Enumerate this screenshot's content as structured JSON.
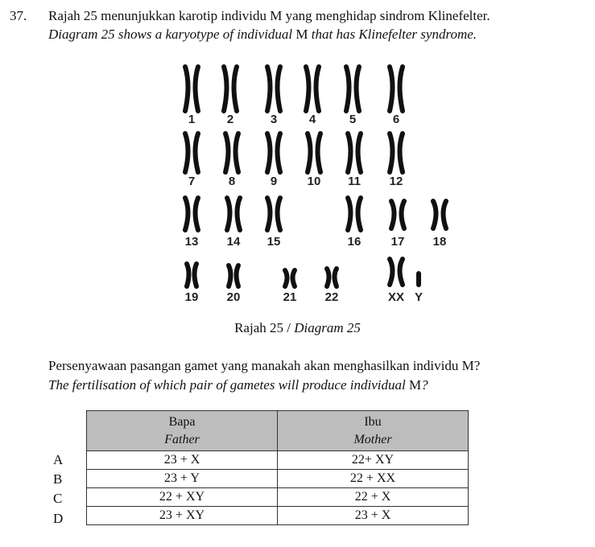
{
  "question": {
    "number": "37.",
    "intro_ms": "Rajah 25 menunjukkan karotip individu M yang menghidap sindrom Klinefelter.",
    "intro_en_part1": "Diagram 25 shows a karyotype of individual ",
    "intro_en_m": "M",
    "intro_en_part2": " that has Klinefelter syndrome.",
    "caption_ms": "Rajah 25 / ",
    "caption_en": "Diagram 25",
    "ask_ms": "Persenyawaan pasangan gamet yang manakah akan menghasilkan individu M?",
    "ask_en_part1": "The fertilisation of which pair of gametes will produce individual ",
    "ask_en_m": "M",
    "ask_en_part2": "?"
  },
  "karyotype": {
    "labels": [
      "1",
      "2",
      "3",
      "4",
      "5",
      "6",
      "7",
      "8",
      "9",
      "10",
      "11",
      "12",
      "13",
      "14",
      "15",
      "16",
      "17",
      "18",
      "19",
      "20",
      "21",
      "22",
      "XX",
      "Y"
    ]
  },
  "table": {
    "father_ms": "Bapa",
    "father_en": "Father",
    "mother_ms": "Ibu",
    "mother_en": "Mother",
    "rows": [
      {
        "letter": "A",
        "father": "23 + X",
        "mother": "22+ XY"
      },
      {
        "letter": "B",
        "father": "23 + Y",
        "mother": "22 + XX"
      },
      {
        "letter": "C",
        "father": "22 + XY",
        "mother": "22 + X"
      },
      {
        "letter": "D",
        "father": "23 + XY",
        "mother": "23 + X"
      }
    ]
  }
}
